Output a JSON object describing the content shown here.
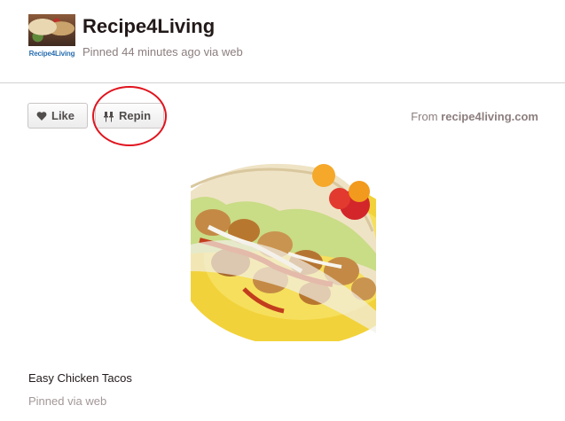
{
  "pin": {
    "board_name": "Recipe4Living",
    "meta": "Pinned 44 minutes ago via web",
    "avatar_logo_text": "Recipe4Living",
    "like_label": "Like",
    "repin_label": "Repin",
    "from_prefix": "From ",
    "from_domain": "recipe4living.com",
    "description": "Easy Chicken Tacos",
    "pinned_via": "Pinned via web"
  },
  "icons": {
    "like": "heart-icon",
    "repin": "pushpin-icon"
  },
  "colors": {
    "annotation_circle": "#e0141e",
    "muted_text": "#8c7e7e"
  }
}
